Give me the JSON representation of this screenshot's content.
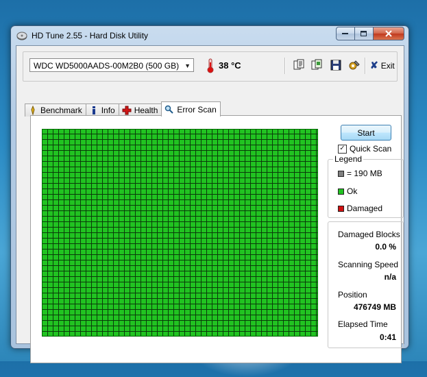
{
  "window": {
    "title": "HD Tune 2.55 - Hard Disk Utility"
  },
  "toolbar": {
    "drive": "WDC WD5000AADS-00M2B0 (500 GB)",
    "temperature": "38 °C",
    "exit_label": "Exit",
    "icons": [
      "copy-text-icon",
      "copy-screenshot-icon",
      "save-icon",
      "options-icon"
    ]
  },
  "tabs": [
    {
      "label": "Benchmark",
      "icon": "benchmark-icon"
    },
    {
      "label": "Info",
      "icon": "info-icon"
    },
    {
      "label": "Health",
      "icon": "health-cross-icon"
    },
    {
      "label": "Error Scan",
      "icon": "magnifier-icon",
      "active": true
    }
  ],
  "scan": {
    "start_label": "Start",
    "quick_scan_label": "Quick Scan",
    "quick_scan_checked": true,
    "block_color": "#21c321"
  },
  "legend": {
    "title": "Legend",
    "items": [
      {
        "label": "= 190 MB",
        "color": "#808080"
      },
      {
        "label": "Ok",
        "color": "#21c321"
      },
      {
        "label": "Damaged",
        "color": "#d01010"
      }
    ]
  },
  "stats": {
    "damaged_blocks_label": "Damaged Blocks",
    "damaged_blocks_value": "0.0 %",
    "scanning_speed_label": "Scanning Speed",
    "scanning_speed_value": "n/a",
    "position_label": "Position",
    "position_value": "476749 MB",
    "elapsed_time_label": "Elapsed Time",
    "elapsed_time_value": "0:41"
  }
}
